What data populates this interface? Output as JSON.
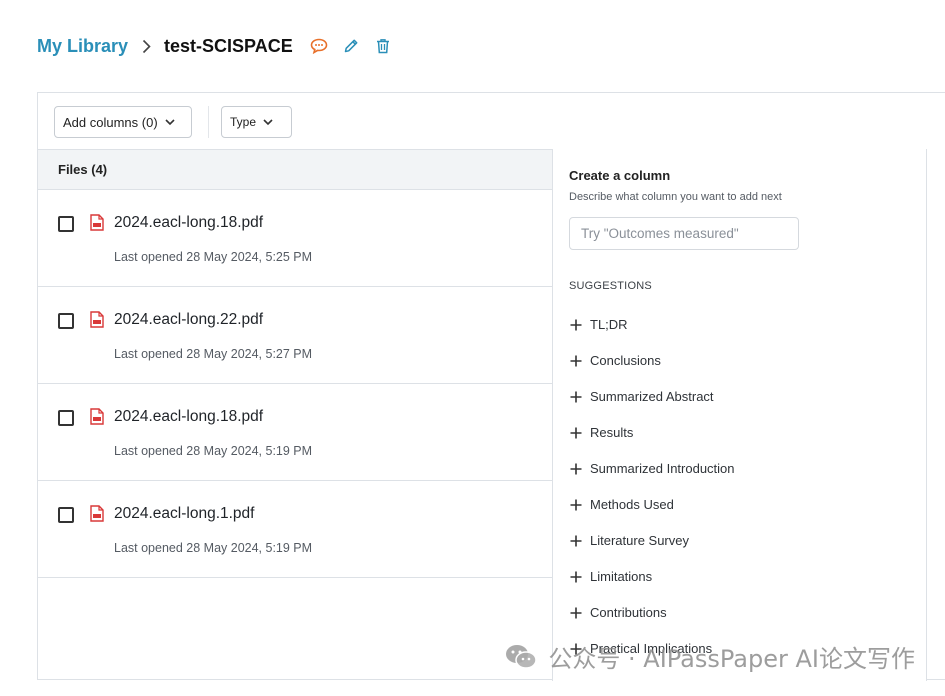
{
  "breadcrumb": {
    "root": "My Library",
    "current": "test-SCISPACE"
  },
  "header_icons": [
    "chat-icon",
    "pencil-icon",
    "trash-icon"
  ],
  "toolbar": {
    "add_columns_label": "Add columns (0)",
    "type_label": "Type"
  },
  "files": {
    "header": "Files (4)",
    "rows": [
      {
        "name": "2024.eacl-long.18.pdf",
        "meta": "Last opened 28 May 2024, 5:25 PM"
      },
      {
        "name": "2024.eacl-long.22.pdf",
        "meta": "Last opened 28 May 2024, 5:27 PM"
      },
      {
        "name": "2024.eacl-long.18.pdf",
        "meta": "Last opened 28 May 2024, 5:19 PM"
      },
      {
        "name": "2024.eacl-long.1.pdf",
        "meta": "Last opened 28 May 2024, 5:19 PM"
      }
    ]
  },
  "create_column": {
    "title": "Create a column",
    "description": "Describe what column you want to add next",
    "placeholder": "Try \"Outcomes measured\"",
    "suggestions_title": "SUGGESTIONS",
    "suggestions": [
      "TL;DR",
      "Conclusions",
      "Summarized Abstract",
      "Results",
      "Summarized Introduction",
      "Methods Used",
      "Literature Survey",
      "Limitations",
      "Contributions",
      "Practical Implications"
    ]
  },
  "watermark": "公众号 · AIPassPaper AI论文写作",
  "colors": {
    "accent": "#2a8fb8",
    "chat_icon": "#e8702a",
    "pdf_red": "#d93838"
  }
}
